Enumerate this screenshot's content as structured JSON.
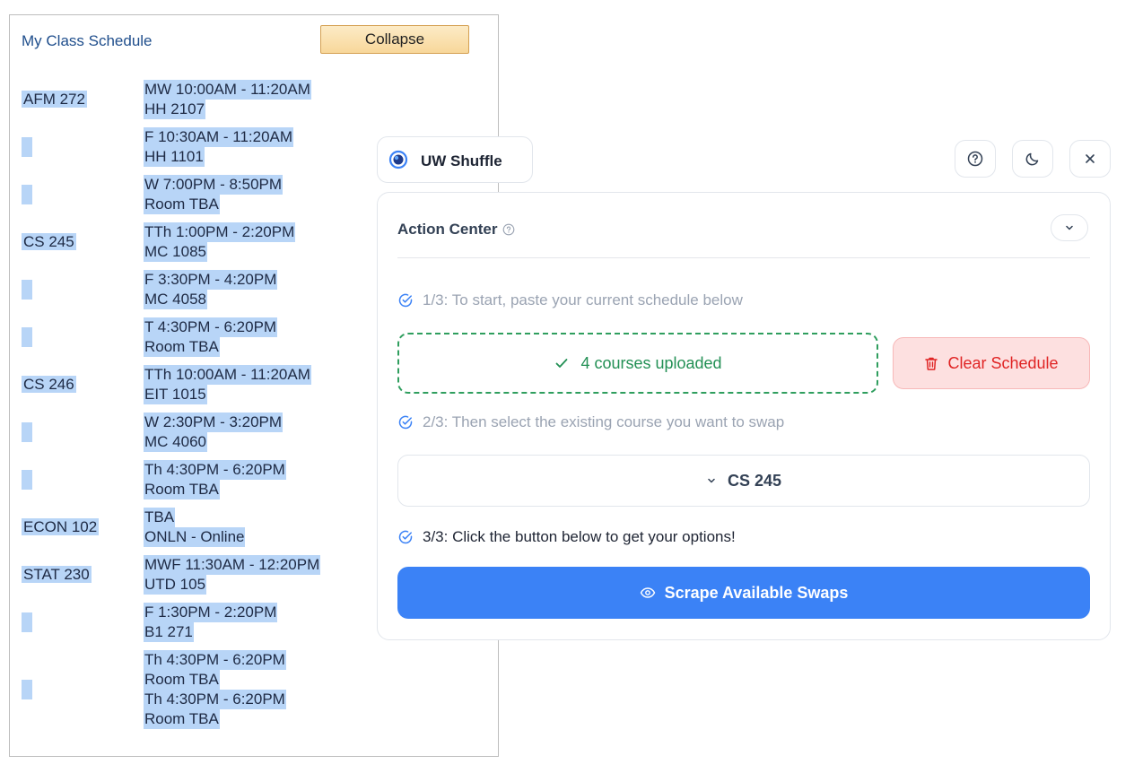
{
  "schedule": {
    "title": "My Class Schedule",
    "collapse_label": "Collapse",
    "rows": [
      {
        "code": "AFM 272",
        "lines": [
          "MW 10:00AM - 11:20AM",
          "HH 2107"
        ]
      },
      {
        "code": "",
        "lines": [
          "F 10:30AM - 11:20AM",
          "HH 1101"
        ]
      },
      {
        "code": "",
        "lines": [
          "W 7:00PM - 8:50PM",
          "Room  TBA"
        ]
      },
      {
        "code": "CS 245",
        "lines": [
          "TTh 1:00PM - 2:20PM",
          "MC 1085"
        ]
      },
      {
        "code": "",
        "lines": [
          "F 3:30PM - 4:20PM",
          "MC 4058"
        ]
      },
      {
        "code": "",
        "lines": [
          "T 4:30PM - 6:20PM",
          "Room  TBA"
        ]
      },
      {
        "code": "CS 246",
        "lines": [
          "TTh 10:00AM - 11:20AM",
          "EIT 1015"
        ]
      },
      {
        "code": "",
        "lines": [
          "W 2:30PM - 3:20PM",
          "MC 4060"
        ]
      },
      {
        "code": "",
        "lines": [
          "Th 4:30PM - 6:20PM",
          "Room  TBA"
        ]
      },
      {
        "code": "ECON 102",
        "lines": [
          "TBA",
          "ONLN - Online"
        ]
      },
      {
        "code": "STAT 230",
        "lines": [
          "MWF 11:30AM - 12:20PM",
          "UTD 105"
        ]
      },
      {
        "code": "",
        "lines": [
          "F 1:30PM - 2:20PM",
          "B1 271"
        ]
      },
      {
        "code": "",
        "lines": [
          "Th 4:30PM - 6:20PM",
          "Room  TBA",
          "Th 4:30PM - 6:20PM",
          "Room  TBA"
        ]
      }
    ]
  },
  "extension": {
    "app_name": "UW Shuffle",
    "header_icons": [
      "help-icon",
      "moon-icon",
      "close-icon"
    ],
    "action_center": {
      "title": "Action Center",
      "step1": "1/3: To start, paste your current schedule below",
      "upload_status": "4 courses uploaded",
      "clear_label": "Clear Schedule",
      "step2": "2/3: Then select the existing course you want to swap",
      "selected_course": "CS 245",
      "step3": "3/3: Click the button below to get your options!",
      "scrape_label": "Scrape Available Swaps"
    }
  },
  "colors": {
    "accent": "#3b82f6",
    "success": "#239055",
    "danger": "#e02424",
    "highlight": "#b8d5f7"
  }
}
